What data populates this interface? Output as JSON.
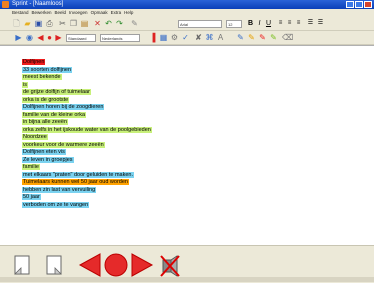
{
  "window": {
    "title": "Sprint - [Naamloos]"
  },
  "menu": [
    "Bestand",
    "Bewerken",
    "Beeld",
    "Invoegen",
    "Opmaak",
    "Extra",
    "Help"
  ],
  "toolbar": {
    "font_name": "Arial",
    "font_size": "12",
    "language": "Nederlands",
    "voice": "Standaard"
  },
  "colors": {
    "red": "#ee1c1c",
    "green": "#c8f07a",
    "blue": "#7ad2f0",
    "orange": "#ffa200"
  },
  "document": {
    "lines": [
      {
        "text": "Dolfijnen",
        "color": "red"
      },
      {
        "text": "33 soorten dolfijnen",
        "color": "blue"
      },
      {
        "text": "meest bekende",
        "color": "green"
      },
      {
        "text": "is",
        "color": "green"
      },
      {
        "text": "de grijze dolfijn of tuimelaar",
        "color": "green"
      },
      {
        "text": "orka is de grootste",
        "color": "green"
      },
      {
        "text": "Dolfijnen horen bij de zoogdieren",
        "color": "blue"
      },
      {
        "text": "familie van de kleine orka",
        "color": "green"
      },
      {
        "text": "in bijna alle zeeën",
        "color": "green"
      },
      {
        "text": "orka zelfs in het ijskoude water van de poolgebieden",
        "color": "green"
      },
      {
        "text": "Noordzee",
        "color": "green"
      },
      {
        "text": "voorkeur voor de warmere zeeën",
        "color": "green"
      },
      {
        "text": "Dolfijnen eten vis",
        "color": "blue"
      },
      {
        "text": "Ze leven in groepjes",
        "color": "blue"
      },
      {
        "text": "familie",
        "color": "green"
      },
      {
        "text": "met elkaars \"praten\" door geluiden te maken.",
        "color": "blue"
      },
      {
        "text": "Tuimelaars kunnen wel 50 jaar oud worden",
        "color": "orange"
      },
      {
        "text": "hebben zin last van vervuiling",
        "color": "blue"
      },
      {
        "text": "50 jaar",
        "color": "blue"
      },
      {
        "text": "verboden om ze te vangen",
        "color": "blue"
      }
    ]
  },
  "icons": {
    "new": "new-document-icon",
    "open": "open-folder-icon",
    "save": "save-icon",
    "print": "print-icon",
    "prev": "previous-arrow-icon",
    "stop": "stop-icon",
    "next": "next-arrow-icon",
    "mute": "mute-speaker-icon"
  }
}
